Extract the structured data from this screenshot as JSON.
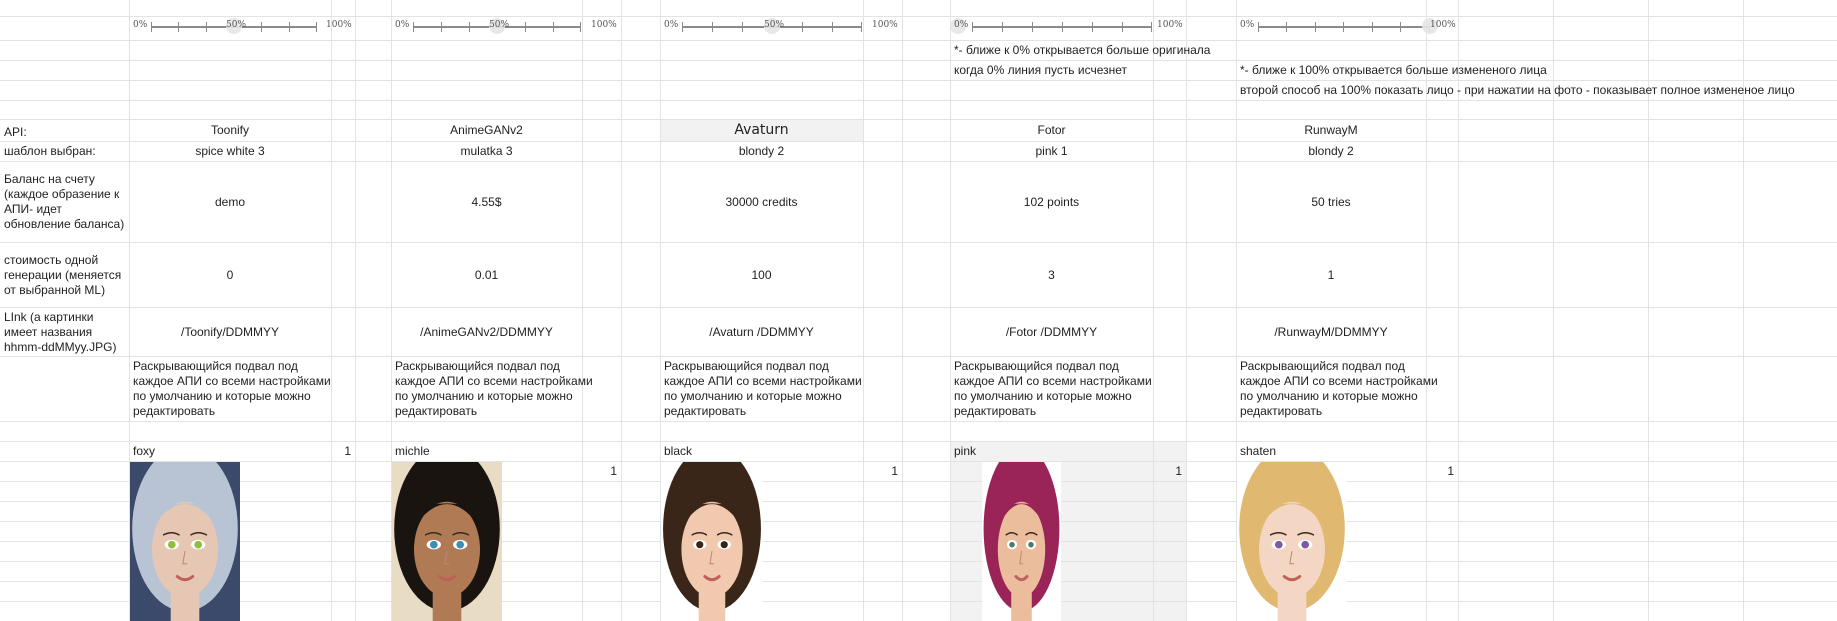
{
  "sliders": [
    {
      "min": "0%",
      "mid": "50%",
      "max": "100%"
    },
    {
      "min": "0%",
      "mid": "50%",
      "max": "100%"
    },
    {
      "min": "0%",
      "mid": "50%",
      "max": "100%"
    },
    {
      "min": "0%",
      "max": "100%"
    },
    {
      "min": "0%",
      "max": "100%"
    }
  ],
  "notes": {
    "near_zero": "*- ближе к 0% открывается больше оригинала",
    "zero_line": "когда 0% линия пусть исчезнет",
    "near_hundred": "*- ближе к 100% открывается больше измененого лица",
    "second_way": "второй способ на 100% показать лицо - при нажатии на фото - показывает полное измененое лицо"
  },
  "labels": {
    "api": "API:",
    "template": "шаблон выбран:",
    "balance": "Баланс на счету (каждое образение к АПИ- идет обновление баланса)",
    "cost": "стоимость одной генерации (меняется от выбранной ML)",
    "link": "LInk (а картинки имеет названия hhmm-ddMMyy.JPG)"
  },
  "columns": [
    {
      "api": "Toonify",
      "template": "spice white 3",
      "balance": "demo",
      "cost": "0",
      "link": "/Toonify/DDMMYY",
      "footer": "Раскрывающийся подвал под каждое АПИ со всеми настройками по умолчанию и которые можно редактировать",
      "name": "foxy",
      "count": "1"
    },
    {
      "api": "AnimeGANv2",
      "template": "mulatka 3",
      "balance": "4.55$",
      "cost": "0.01",
      "link": "/AnimeGANv2/DDMMYY",
      "footer": "Раскрывающийся подвал под каждое АПИ со всеми настройками по умолчанию и которые можно редактировать",
      "name": "michle",
      "count": "1"
    },
    {
      "api": "Avaturn",
      "template": "blondy 2",
      "balance": "30000 credits",
      "cost": "100",
      "link": "/Avaturn /DDMMYY",
      "footer": "Раскрывающийся подвал под каждое АПИ со всеми настройками по умолчанию и которые можно редактировать",
      "name": "black",
      "count": "1"
    },
    {
      "api": "Fotor",
      "template": "pink 1",
      "balance": "102 points",
      "cost": "3",
      "link": "/Fotor /DDMMYY",
      "footer": "Раскрывающийся подвал под каждое АПИ со всеми настройками по умолчанию и которые можно редактировать",
      "name": "pink",
      "count": "1"
    },
    {
      "api": "RunwayM",
      "template": "blondy 2",
      "balance": "50 tries",
      "cost": "1",
      "link": "/RunwayM/DDMMYY",
      "footer": "Раскрывающийся подвал под каждое АПИ со всеми настройками по умолчанию и которые можно редактировать",
      "name": "shaten",
      "count": "1"
    }
  ],
  "colors": {
    "grid": "#e2e3e3",
    "selected_fill": "#f2f2f2",
    "text": "#1f1f1f",
    "slider_track": "#8a8a8a"
  },
  "portraits": [
    {
      "hair": "#b8c4d4",
      "skin": "#e6c7b4",
      "eyes": "#8fbf3a",
      "bg": "#3b4a6b"
    },
    {
      "hair": "#1a1410",
      "skin": "#b07a55",
      "eyes": "#3b8fb0",
      "bg": "#e8dcc4"
    },
    {
      "hair": "#3a2618",
      "skin": "#f0c9ae",
      "eyes": "#3a2414",
      "bg": "#ffffff"
    },
    {
      "hair": "#9a2458",
      "skin": "#ebbd9c",
      "eyes": "#4a7a70",
      "bg": "#ffffff"
    },
    {
      "hair": "#e0b870",
      "skin": "#f4d6c4",
      "eyes": "#7a5aa0",
      "bg": "#ffffff"
    }
  ]
}
